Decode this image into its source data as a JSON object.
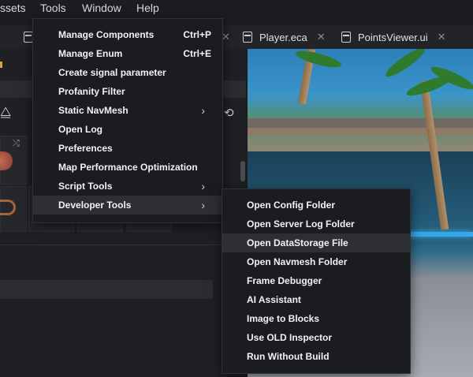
{
  "menubar": {
    "items": [
      {
        "label": "ssets"
      },
      {
        "label": "Tools"
      },
      {
        "label": "Window"
      },
      {
        "label": "Help"
      }
    ]
  },
  "tabs": [
    {
      "label": "Player.eca",
      "icon": "file-icon"
    },
    {
      "label": "PointsViewer.ui",
      "icon": "file-icon"
    }
  ],
  "tools_menu": {
    "items": [
      {
        "label": "Manage Components",
        "shortcut": "Ctrl+P"
      },
      {
        "label": "Manage Enum",
        "shortcut": "Ctrl+E"
      },
      {
        "label": "Create signal parameter"
      },
      {
        "label": "Profanity Filter"
      },
      {
        "label": "Static NavMesh",
        "submenu": "chevron-right-icon"
      },
      {
        "label": "Open Log"
      },
      {
        "label": "Preferences"
      },
      {
        "label": "Map Performance Optimization"
      },
      {
        "label": "Script Tools",
        "submenu": "chevron-right-icon"
      },
      {
        "label": "Developer Tools",
        "submenu": "chevron-right-icon",
        "highlighted": true
      }
    ]
  },
  "developer_tools_menu": {
    "items": [
      {
        "label": "Open Config Folder"
      },
      {
        "label": "Open Server Log Folder"
      },
      {
        "label": "Open DataStorage File",
        "highlighted": true
      },
      {
        "label": "Open Navmesh Folder"
      },
      {
        "label": "Frame Debugger"
      },
      {
        "label": "AI Assistant"
      },
      {
        "label": "Image to Blocks"
      },
      {
        "label": "Use OLD Inspector"
      },
      {
        "label": "Run Without Build"
      }
    ]
  },
  "colors": {
    "menu_bg": "#1b1c1f",
    "menu_highlight": "#2d2f35",
    "app_bg": "#1c1d20",
    "accent_orange": "#e0a040"
  }
}
